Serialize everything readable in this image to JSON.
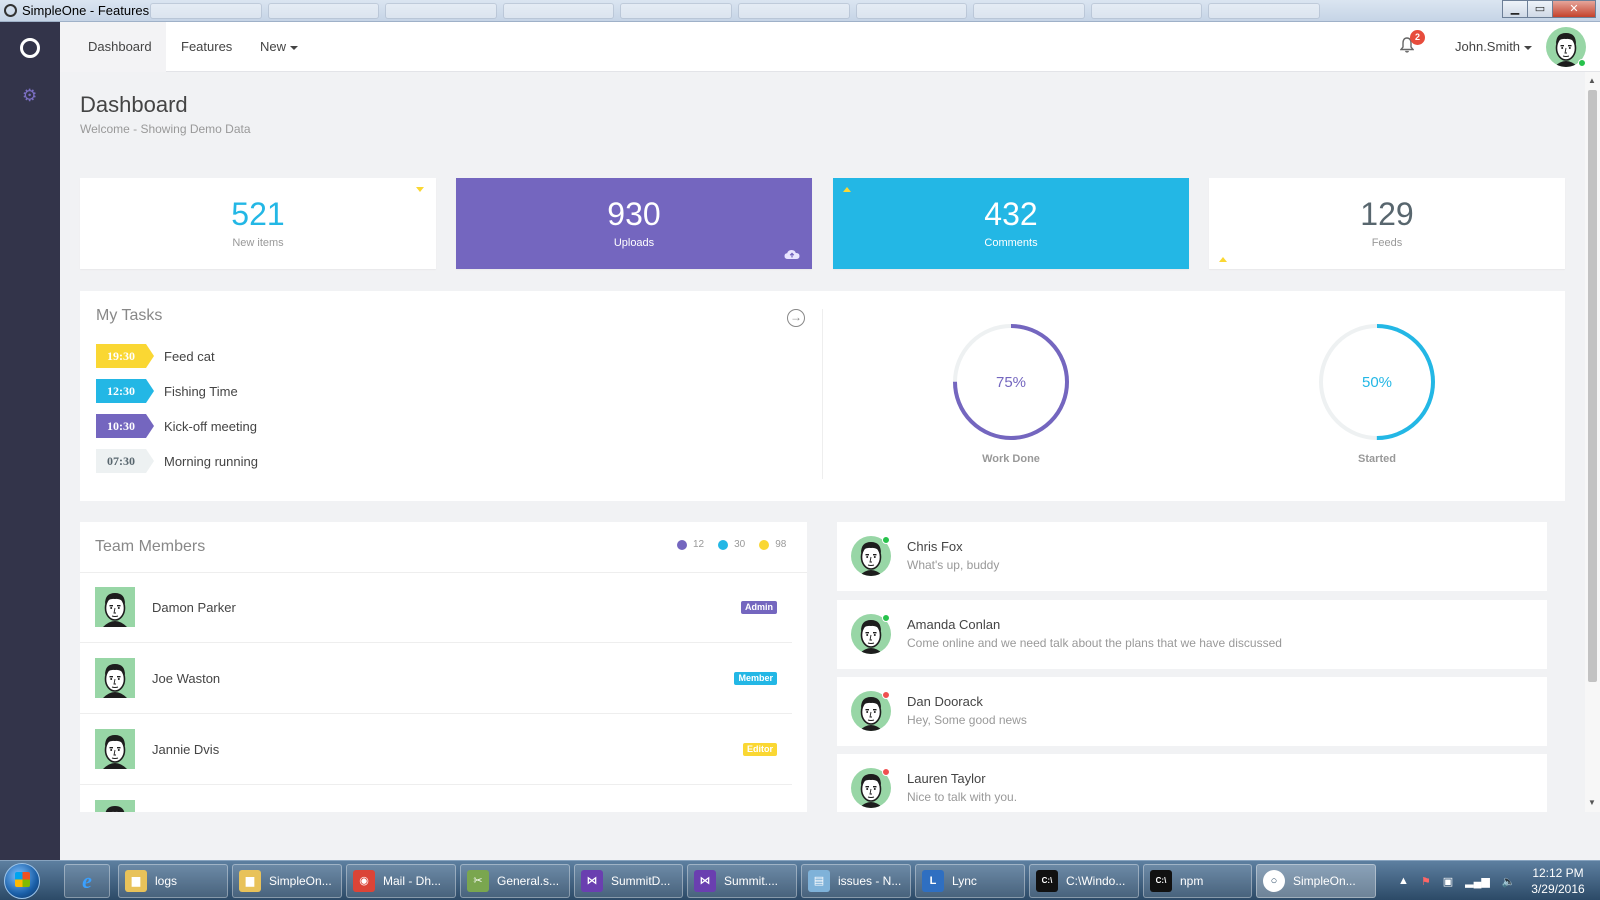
{
  "window": {
    "title": "SimpleOne - Features",
    "minimize": "▁",
    "maximize": "▭",
    "close": "✕"
  },
  "nav": {
    "dashboard": "Dashboard",
    "features": "Features",
    "new": "New",
    "notifications": "2",
    "username": "John.Smith"
  },
  "page": {
    "title": "Dashboard",
    "subtitle": "Welcome - Showing Demo Data"
  },
  "stats": [
    {
      "value": "521",
      "label": "New items",
      "color": "#23b7e5"
    },
    {
      "value": "930",
      "label": "Uploads",
      "color": "#7466bf"
    },
    {
      "value": "432",
      "label": "Comments",
      "color": "#23b7e5"
    },
    {
      "value": "129",
      "label": "Feeds",
      "color": "#58666e"
    }
  ],
  "tasks": {
    "title": "My Tasks",
    "items": [
      {
        "time": "19:30",
        "text": "Feed cat",
        "color": "#fad733"
      },
      {
        "time": "12:30",
        "text": "Fishing Time",
        "color": "#23b7e5"
      },
      {
        "time": "10:30",
        "text": "Kick-off meeting",
        "color": "#7466bf"
      },
      {
        "time": "07:30",
        "text": "Morning running",
        "color": "#edf1f2"
      }
    ]
  },
  "gauges": [
    {
      "label": "Work Done",
      "percent": 75,
      "text": "75%",
      "color": "#7466bf"
    },
    {
      "label": "Started",
      "percent": 50,
      "text": "50%",
      "color": "#23b7e5"
    }
  ],
  "team": {
    "title": "Team Members",
    "legend": [
      {
        "value": "12",
        "color": "#7466bf"
      },
      {
        "value": "30",
        "color": "#23b7e5"
      },
      {
        "value": "98",
        "color": "#fad733"
      }
    ],
    "members": [
      {
        "name": "Damon Parker",
        "role": "Admin",
        "color": "#7466bf"
      },
      {
        "name": "Joe Waston",
        "role": "Member",
        "color": "#23b7e5"
      },
      {
        "name": "Jannie Dvis",
        "role": "Editor",
        "color": "#fad733"
      }
    ]
  },
  "messages": [
    {
      "name": "Chris Fox",
      "text": "What's up, buddy",
      "status": "#27c24c"
    },
    {
      "name": "Amanda Conlan",
      "text": "Come online and we need talk about the plans that we have discussed",
      "status": "#27c24c"
    },
    {
      "name": "Dan Doorack",
      "text": "Hey, Some good news",
      "status": "#f05050"
    },
    {
      "name": "Lauren Taylor",
      "text": "Nice to talk with you.",
      "status": "#f05050"
    }
  ],
  "taskbar": {
    "items": [
      {
        "label": "logs",
        "icon": "folder-icon"
      },
      {
        "label": "SimpleOn...",
        "icon": "folder-icon"
      },
      {
        "label": "Mail - Dh...",
        "icon": "chrome-icon"
      },
      {
        "label": "General.s...",
        "icon": "tools-icon"
      },
      {
        "label": "SummitD...",
        "icon": "visual-studio-icon"
      },
      {
        "label": "Summit....",
        "icon": "visual-studio-icon"
      },
      {
        "label": "issues - N...",
        "icon": "notepad-icon"
      },
      {
        "label": "Lync",
        "icon": "lync-icon"
      },
      {
        "label": "C:\\Windo...",
        "icon": "console-icon"
      },
      {
        "label": "npm",
        "icon": "console-icon"
      },
      {
        "label": "SimpleOn...",
        "icon": "simpleone-icon"
      }
    ],
    "time": "12:12 PM",
    "date": "3/29/2016"
  }
}
